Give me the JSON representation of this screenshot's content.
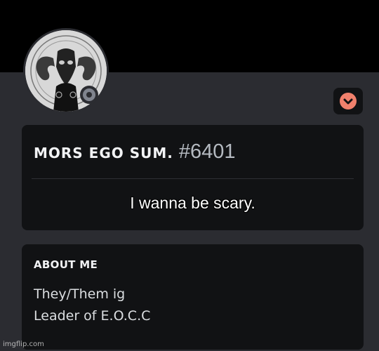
{
  "profile": {
    "display_name": "MORS EGO SUM.",
    "discriminator": "#6401",
    "status_indicator": "offline",
    "avatar": "goat-skull-occult-icon",
    "nitro_badge": "chevron-down-icon"
  },
  "custom_status": "I wanna be scary.",
  "about": {
    "heading": "ABOUT ME",
    "lines": [
      "They/Them ig",
      "Leader of E.O.C.C"
    ]
  },
  "watermark": "imgflip.com",
  "colors": {
    "background": "#000000",
    "card": "#2b2c31",
    "panel": "#111214",
    "accent": "#f0806c",
    "status_offline": "#80848e"
  }
}
